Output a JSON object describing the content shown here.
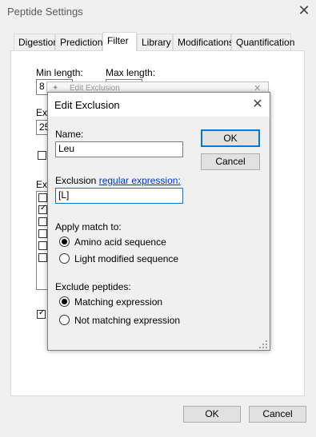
{
  "window": {
    "title": "Peptide Settings"
  },
  "tabs": [
    "Digestion",
    "Prediction",
    "Filter",
    "Library",
    "Modifications",
    "Quantification"
  ],
  "filter": {
    "min_length_label": "Min length:",
    "min_length_value": "8",
    "max_length_label": "Max length:",
    "exclude_n_label": "Ex",
    "exclude_n_value": "25",
    "exclusions_label": "Ex"
  },
  "main_buttons": {
    "ok": "OK",
    "cancel": "Cancel"
  },
  "background_dialog": {
    "title": "Edit Exclusion"
  },
  "dialog": {
    "title": "Edit Exclusion",
    "name_label": "Name:",
    "name_value": "Leu",
    "exclusion_label_prefix": "Exclusion ",
    "exclusion_link": "regular expression:",
    "exclusion_value": "[L]",
    "apply_label": "Apply match to:",
    "apply_options": [
      "Amino acid sequence",
      "Light modified sequence"
    ],
    "apply_selected": 0,
    "exclude_label": "Exclude peptides:",
    "exclude_options": [
      "Matching expression",
      "Not matching expression"
    ],
    "exclude_selected": 0,
    "ok": "OK",
    "cancel": "Cancel"
  }
}
